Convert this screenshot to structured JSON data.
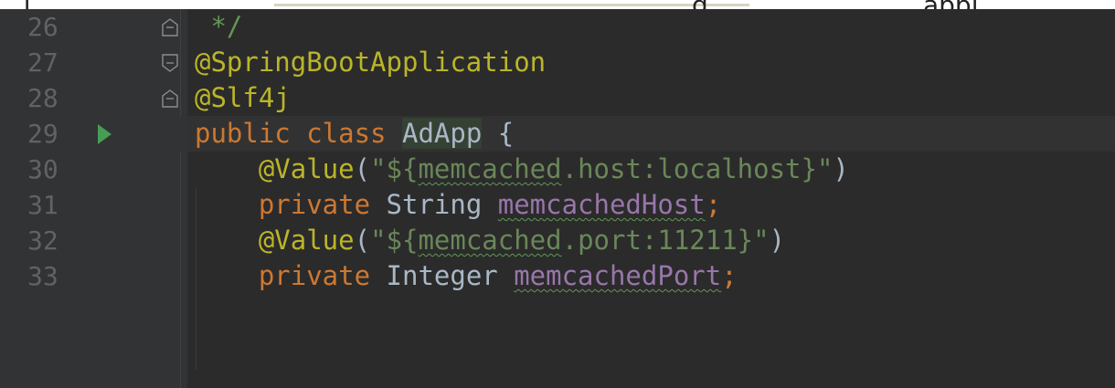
{
  "top_strip": {
    "fragment_left": ", j",
    "fragment_mid": "g",
    "fragment_right": "appj"
  },
  "editor": {
    "lines": [
      {
        "number": "26",
        "tokens": [
          {
            "t": " */",
            "c": "com"
          }
        ]
      },
      {
        "number": "27",
        "tokens": [
          {
            "t": "@SpringBootApplication",
            "c": "ann"
          }
        ]
      },
      {
        "number": "28",
        "tokens": [
          {
            "t": "@Slf4j",
            "c": "ann"
          }
        ]
      },
      {
        "number": "29",
        "tokens": [
          {
            "t": "public class ",
            "c": "kw"
          },
          {
            "t": "AdApp",
            "c": "cls-hl"
          },
          {
            "t": " {",
            "c": ""
          }
        ]
      },
      {
        "number": "30",
        "tokens": [
          {
            "t": "    ",
            "c": ""
          },
          {
            "t": "@Value",
            "c": "ann"
          },
          {
            "t": "(",
            "c": ""
          },
          {
            "t": "\"${",
            "c": "str"
          },
          {
            "t": "memcached",
            "c": "str squig"
          },
          {
            "t": ".host:localhost}\"",
            "c": "str"
          },
          {
            "t": ")",
            "c": ""
          }
        ]
      },
      {
        "number": "31",
        "tokens": [
          {
            "t": "    ",
            "c": ""
          },
          {
            "t": "private ",
            "c": "kw"
          },
          {
            "t": "String ",
            "c": ""
          },
          {
            "t": "memcachedHost",
            "c": "fld squig"
          },
          {
            "t": ";",
            "c": "kw"
          }
        ]
      },
      {
        "number": "32",
        "tokens": [
          {
            "t": "    ",
            "c": ""
          },
          {
            "t": "@Value",
            "c": "ann"
          },
          {
            "t": "(",
            "c": ""
          },
          {
            "t": "\"${",
            "c": "str"
          },
          {
            "t": "memcached",
            "c": "str squig"
          },
          {
            "t": ".port:11211}\"",
            "c": "str"
          },
          {
            "t": ")",
            "c": ""
          }
        ]
      },
      {
        "number": "33",
        "tokens": [
          {
            "t": "    ",
            "c": ""
          },
          {
            "t": "private ",
            "c": "kw"
          },
          {
            "t": "Integer ",
            "c": ""
          },
          {
            "t": "memcachedPort",
            "c": "fld squig"
          },
          {
            "t": ";",
            "c": "kw"
          }
        ]
      }
    ],
    "run_gutter_line": "29",
    "fold_markers": {
      "26": "end",
      "27": "start",
      "28": "end"
    },
    "colors": {
      "background": "#2b2b2b",
      "gutter": "#313335",
      "line_number": "#606366",
      "keyword": "#cc7832",
      "annotation": "#bbb529",
      "string": "#6a8759",
      "field": "#9876aa",
      "comment": "#629755",
      "run_icon": "#499c54"
    }
  }
}
